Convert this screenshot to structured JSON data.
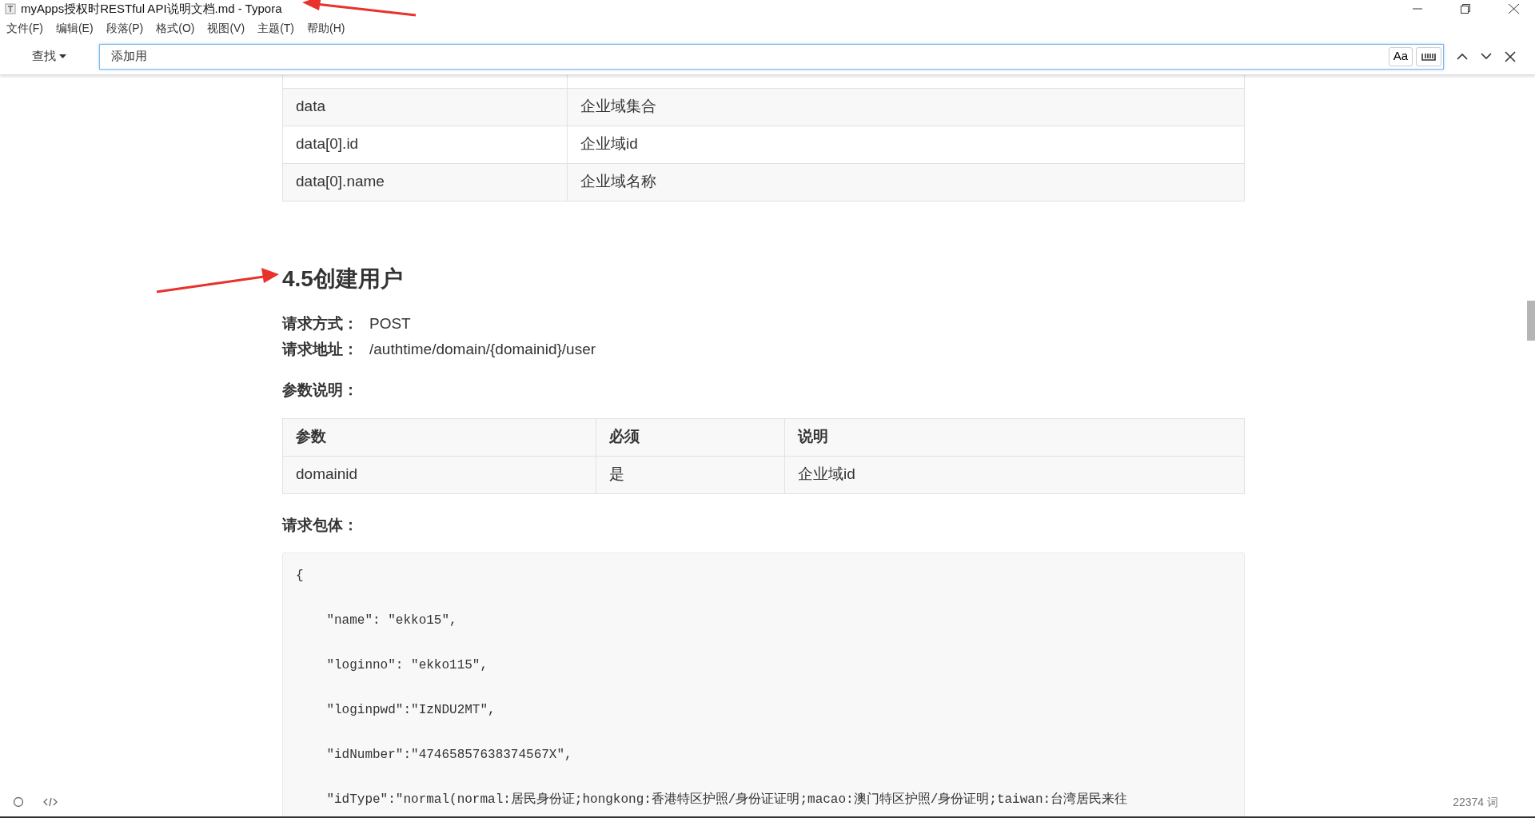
{
  "window": {
    "title": "myApps授权时RESTful API说明文档.md - Typora"
  },
  "menu": [
    "文件(F)",
    "编辑(E)",
    "段落(P)",
    "格式(O)",
    "视图(V)",
    "主题(T)",
    "帮助(H)"
  ],
  "find": {
    "mode": "查找",
    "value": "添加用",
    "case_label": "Aa"
  },
  "result_table": {
    "rows": [
      [
        "data",
        "企业域集合"
      ],
      [
        "data[0].id",
        "企业域id"
      ],
      [
        "data[0].name",
        "企业域名称"
      ]
    ]
  },
  "heading": "4.5创建用户",
  "fields": [
    {
      "label": "请求方式：",
      "value": "POST"
    },
    {
      "label": "请求地址：",
      "value": "/authtime/domain/{domainid}/user"
    }
  ],
  "params_heading": "参数说明：",
  "params_table": {
    "columns": [
      "参数",
      "必须",
      "说明"
    ],
    "rows": [
      [
        "domainid",
        "是",
        "企业域id"
      ]
    ]
  },
  "body_heading": "请求包体：",
  "code_lines": [
    "{",
    "    \"name\": \"ekko15\",",
    "    \"loginno\": \"ekko115\",",
    "    \"loginpwd\":\"IzNDU2MT\",",
    "    \"idNumber\":\"47465857638374567X\",",
    "    \"idType\":\"normal(normal:居民身份证;hongkong:香港特区护照/身份证证明;macao:澳门特区护照/身份证明;taiwan:台湾居民来往"
  ],
  "status_bar": {
    "word_count": "22374 词"
  }
}
